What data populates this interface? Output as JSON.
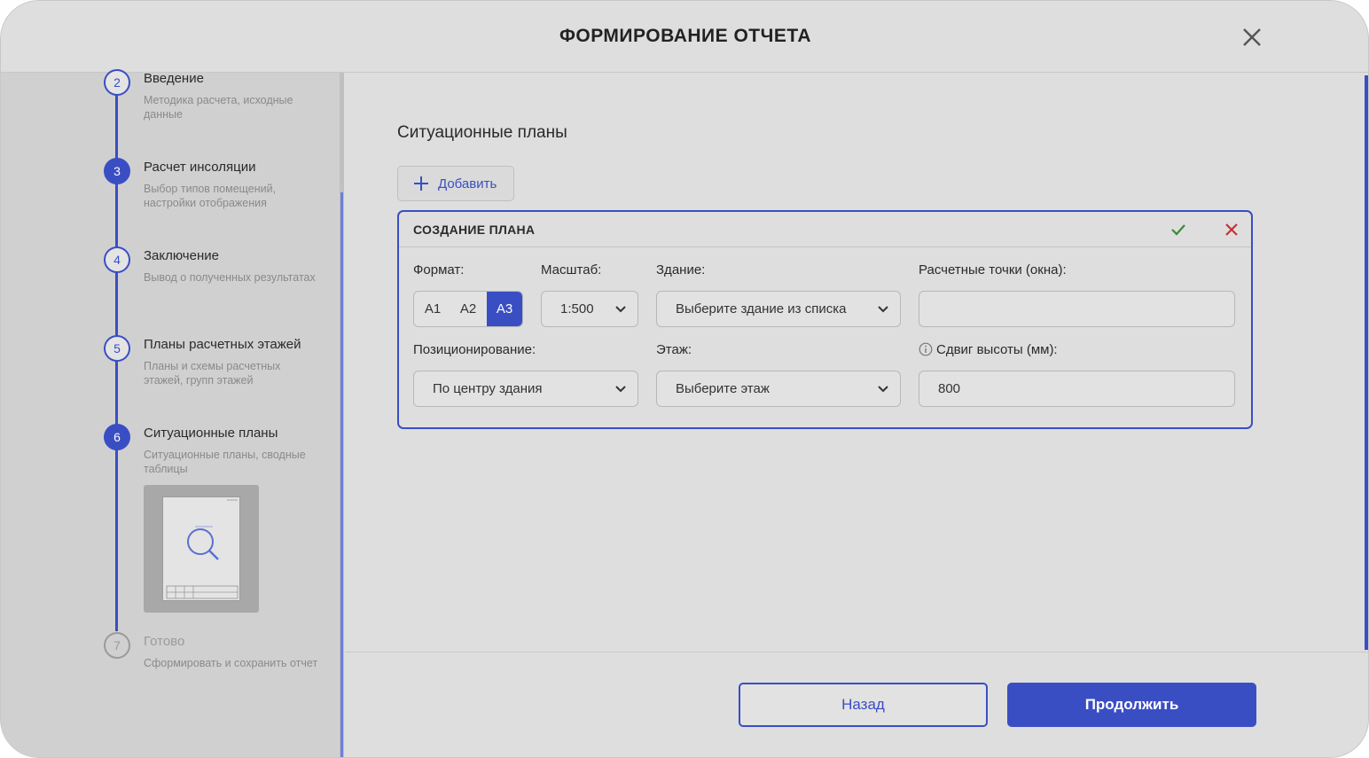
{
  "header": {
    "title": "ФОРМИРОВАНИЕ ОТЧЕТА",
    "close_icon": "close-icon"
  },
  "steps": [
    {
      "num": "2",
      "title": "Введение",
      "subtitle": "Методика расчета, исходные данные",
      "state": "done"
    },
    {
      "num": "3",
      "title": "Расчет инсоляции",
      "subtitle": "Выбор типов помещений, настройки отображения",
      "state": "active"
    },
    {
      "num": "4",
      "title": "Заключение",
      "subtitle": "Вывод о полученных результатах",
      "state": "done"
    },
    {
      "num": "5",
      "title": "Планы расчетных этажей",
      "subtitle": "Планы и схемы расчетных этажей, групп этажей",
      "state": "done"
    },
    {
      "num": "6",
      "title": "Ситуационные планы",
      "subtitle": "Ситуационные планы, сводные таблицы",
      "state": "active"
    },
    {
      "num": "7",
      "title": "Готово",
      "subtitle": "Сформировать и сохранить отчет",
      "state": "disabled"
    }
  ],
  "main": {
    "section_title": "Ситуационные планы",
    "add_button": "Добавить",
    "card": {
      "title": "СОЗДАНИЕ ПЛАНА",
      "format_label": "Формат:",
      "format_options": [
        "A1",
        "A2",
        "A3"
      ],
      "format_selected": "A3",
      "scale_label": "Масштаб:",
      "scale_value": "1:500",
      "building_label": "Здание:",
      "building_placeholder": "Выберите здание из списка",
      "points_label": "Расчетные точки (окна):",
      "points_value": "",
      "positioning_label": "Позиционирование:",
      "positioning_value": "По центру здания",
      "floor_label": "Этаж:",
      "floor_placeholder": "Выберите этаж",
      "height_shift_label": "Сдвиг высоты (мм):",
      "height_shift_value": "800"
    }
  },
  "footer": {
    "back_label": "Назад",
    "next_label": "Продолжить"
  },
  "colors": {
    "accent": "#3a4ec4",
    "ok": "#3a8a3a",
    "cancel": "#c83232"
  }
}
